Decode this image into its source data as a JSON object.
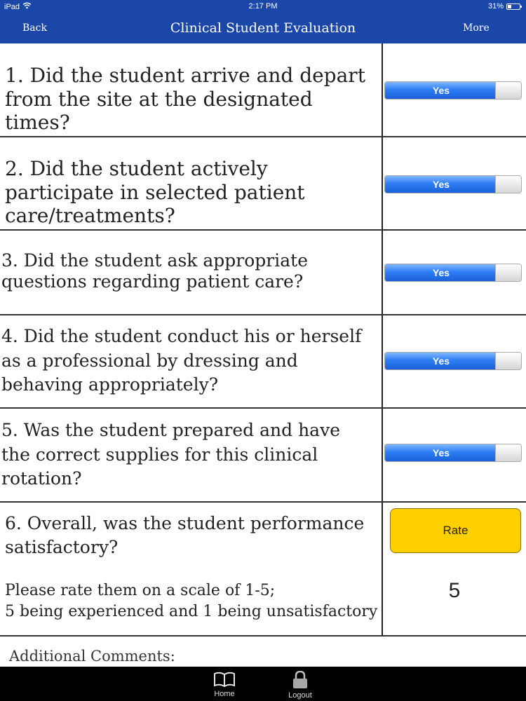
{
  "status_bar": {
    "device": "iPad",
    "time": "2:17 PM",
    "battery": "31%",
    "battery_level": 0.31,
    "wifi_icon": "wifi-icon",
    "battery_icon": "battery-icon"
  },
  "nav": {
    "back_label": "Back",
    "title": "Clinical Student Evaluation",
    "more_label": "More"
  },
  "questions": [
    {
      "text": "1. Did the student arrive and depart from the site at the designated times?",
      "toggle": "Yes"
    },
    {
      "text": "2. Did the student actively participate in selected patient care/treatments?",
      "toggle": "Yes"
    },
    {
      "text": "3. Did the student ask appropriate questions regarding patient care?",
      "toggle": "Yes"
    },
    {
      "text": "4. Did the student conduct his or herself as a professional by dressing and behaving appropriately?",
      "toggle": "Yes"
    },
    {
      "text": "5. Was the student prepared and have the correct supplies for this clinical rotation?",
      "toggle": "Yes"
    }
  ],
  "rating": {
    "question": "6. Overall, was the student performance satisfactory?",
    "button_label": "Rate",
    "button_color": "#ffd000",
    "hint_line1": "Please rate them on a scale of 1-5;",
    "hint_line2": "5 being experienced and 1 being unsatisfactory",
    "value": "5"
  },
  "comments_label": "Additional Comments:",
  "tab_bar": {
    "home_label": "Home",
    "home_icon": "book-icon",
    "logout_label": "Logout",
    "logout_icon": "lock-icon"
  },
  "colors": {
    "nav_blue": "#1b47a8",
    "toggle_blue": "#2f7ef5"
  }
}
